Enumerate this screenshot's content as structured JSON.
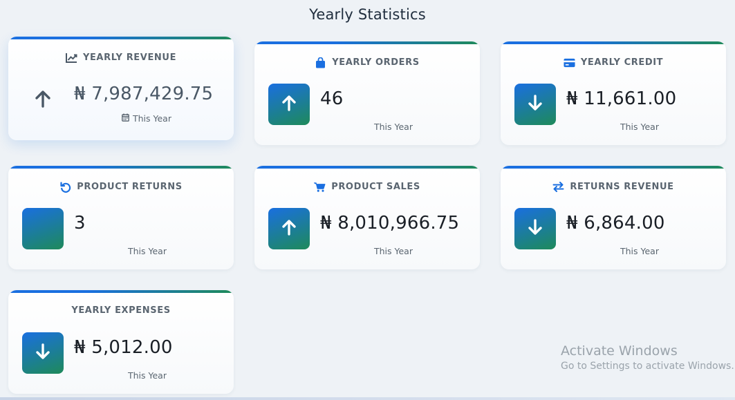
{
  "page": {
    "title": "Yearly Statistics"
  },
  "cards": [
    {
      "title": "YEARLY REVENUE",
      "value": "₦ 7,987,429.75",
      "period": "This Year",
      "header_icon": "chart-line-icon",
      "trend_icon": "arrow-up-icon"
    },
    {
      "title": "YEARLY ORDERS",
      "value": "46",
      "period": "This Year",
      "header_icon": "shopping-bag-icon",
      "trend_icon": "arrow-up-icon"
    },
    {
      "title": "YEARLY CREDIT",
      "value": "₦ 11,661.00",
      "period": "This Year",
      "header_icon": "credit-card-icon",
      "trend_icon": "arrow-down-icon"
    },
    {
      "title": "PRODUCT RETURNS",
      "value": "3",
      "period": "This Year",
      "header_icon": "undo-icon",
      "trend_icon": ""
    },
    {
      "title": "PRODUCT SALES",
      "value": "₦ 8,010,966.75",
      "period": "This Year",
      "header_icon": "cart-icon",
      "trend_icon": "arrow-up-icon"
    },
    {
      "title": "RETURNS REVENUE",
      "value": "₦ 6,864.00",
      "period": "This Year",
      "header_icon": "exchange-icon",
      "trend_icon": "arrow-down-icon"
    },
    {
      "title": "YEARLY EXPENSES",
      "value": "₦ 5,012.00",
      "period": "This Year",
      "header_icon": "",
      "trend_icon": "arrow-down-icon"
    }
  ],
  "watermark": {
    "title": "Activate Windows",
    "subtitle": "Go to Settings to activate Windows."
  },
  "colors": {
    "accent_blue": "#1a6fe0",
    "accent_green": "#1e8a5a",
    "page_bg": "#eef2f6"
  }
}
